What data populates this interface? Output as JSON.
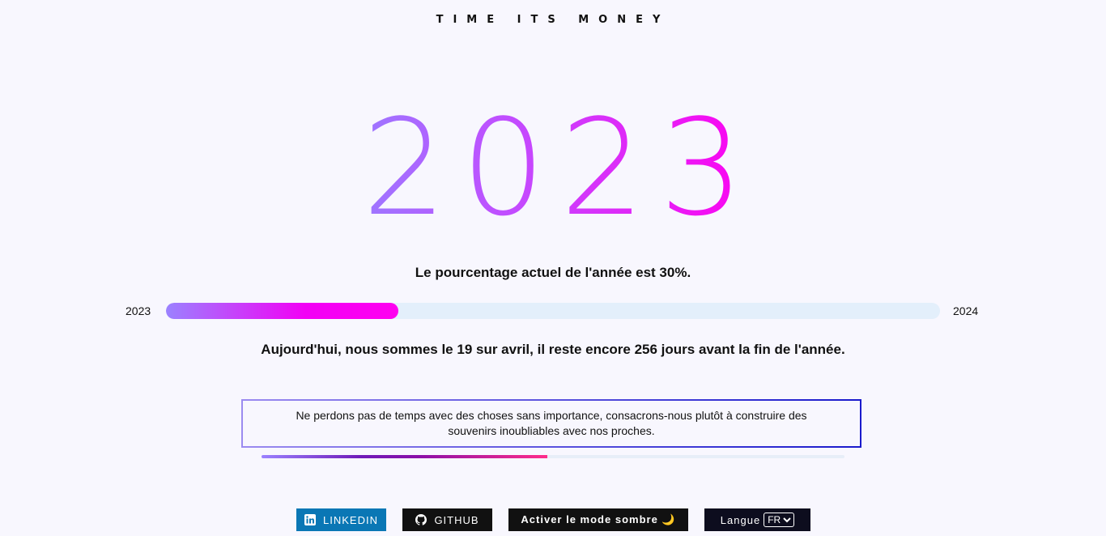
{
  "header": {
    "brand": "TIME ITS MONEY"
  },
  "year": {
    "current": "2023",
    "start_label": "2023",
    "end_label": "2024",
    "percentage_text": "Le pourcentage actuel de l'année est 30%.",
    "progress_percent": 30,
    "today_text": "Aujourd'hui, nous sommes le 19 sur avril, il reste encore 256 jours avant la fin de l'année."
  },
  "quote": {
    "text": "Ne perdons pas de temps avec des choses sans importance, consacrons-nous plutôt à construire des souvenirs inoubliables avec nos proches.",
    "progress_percent": 49
  },
  "footer": {
    "linkedin_label": "LINKEDIN",
    "github_label": "GITHUB",
    "dark_mode_label": "Activer le mode sombre 🌙",
    "language_label": "Langue",
    "language_selected": "FR",
    "language_options": [
      "FR"
    ]
  },
  "colors": {
    "linkedin": "#0a77b5",
    "gradient_start": "#9a7bff",
    "gradient_end": "#ff00f0",
    "track": "#e3effb"
  }
}
